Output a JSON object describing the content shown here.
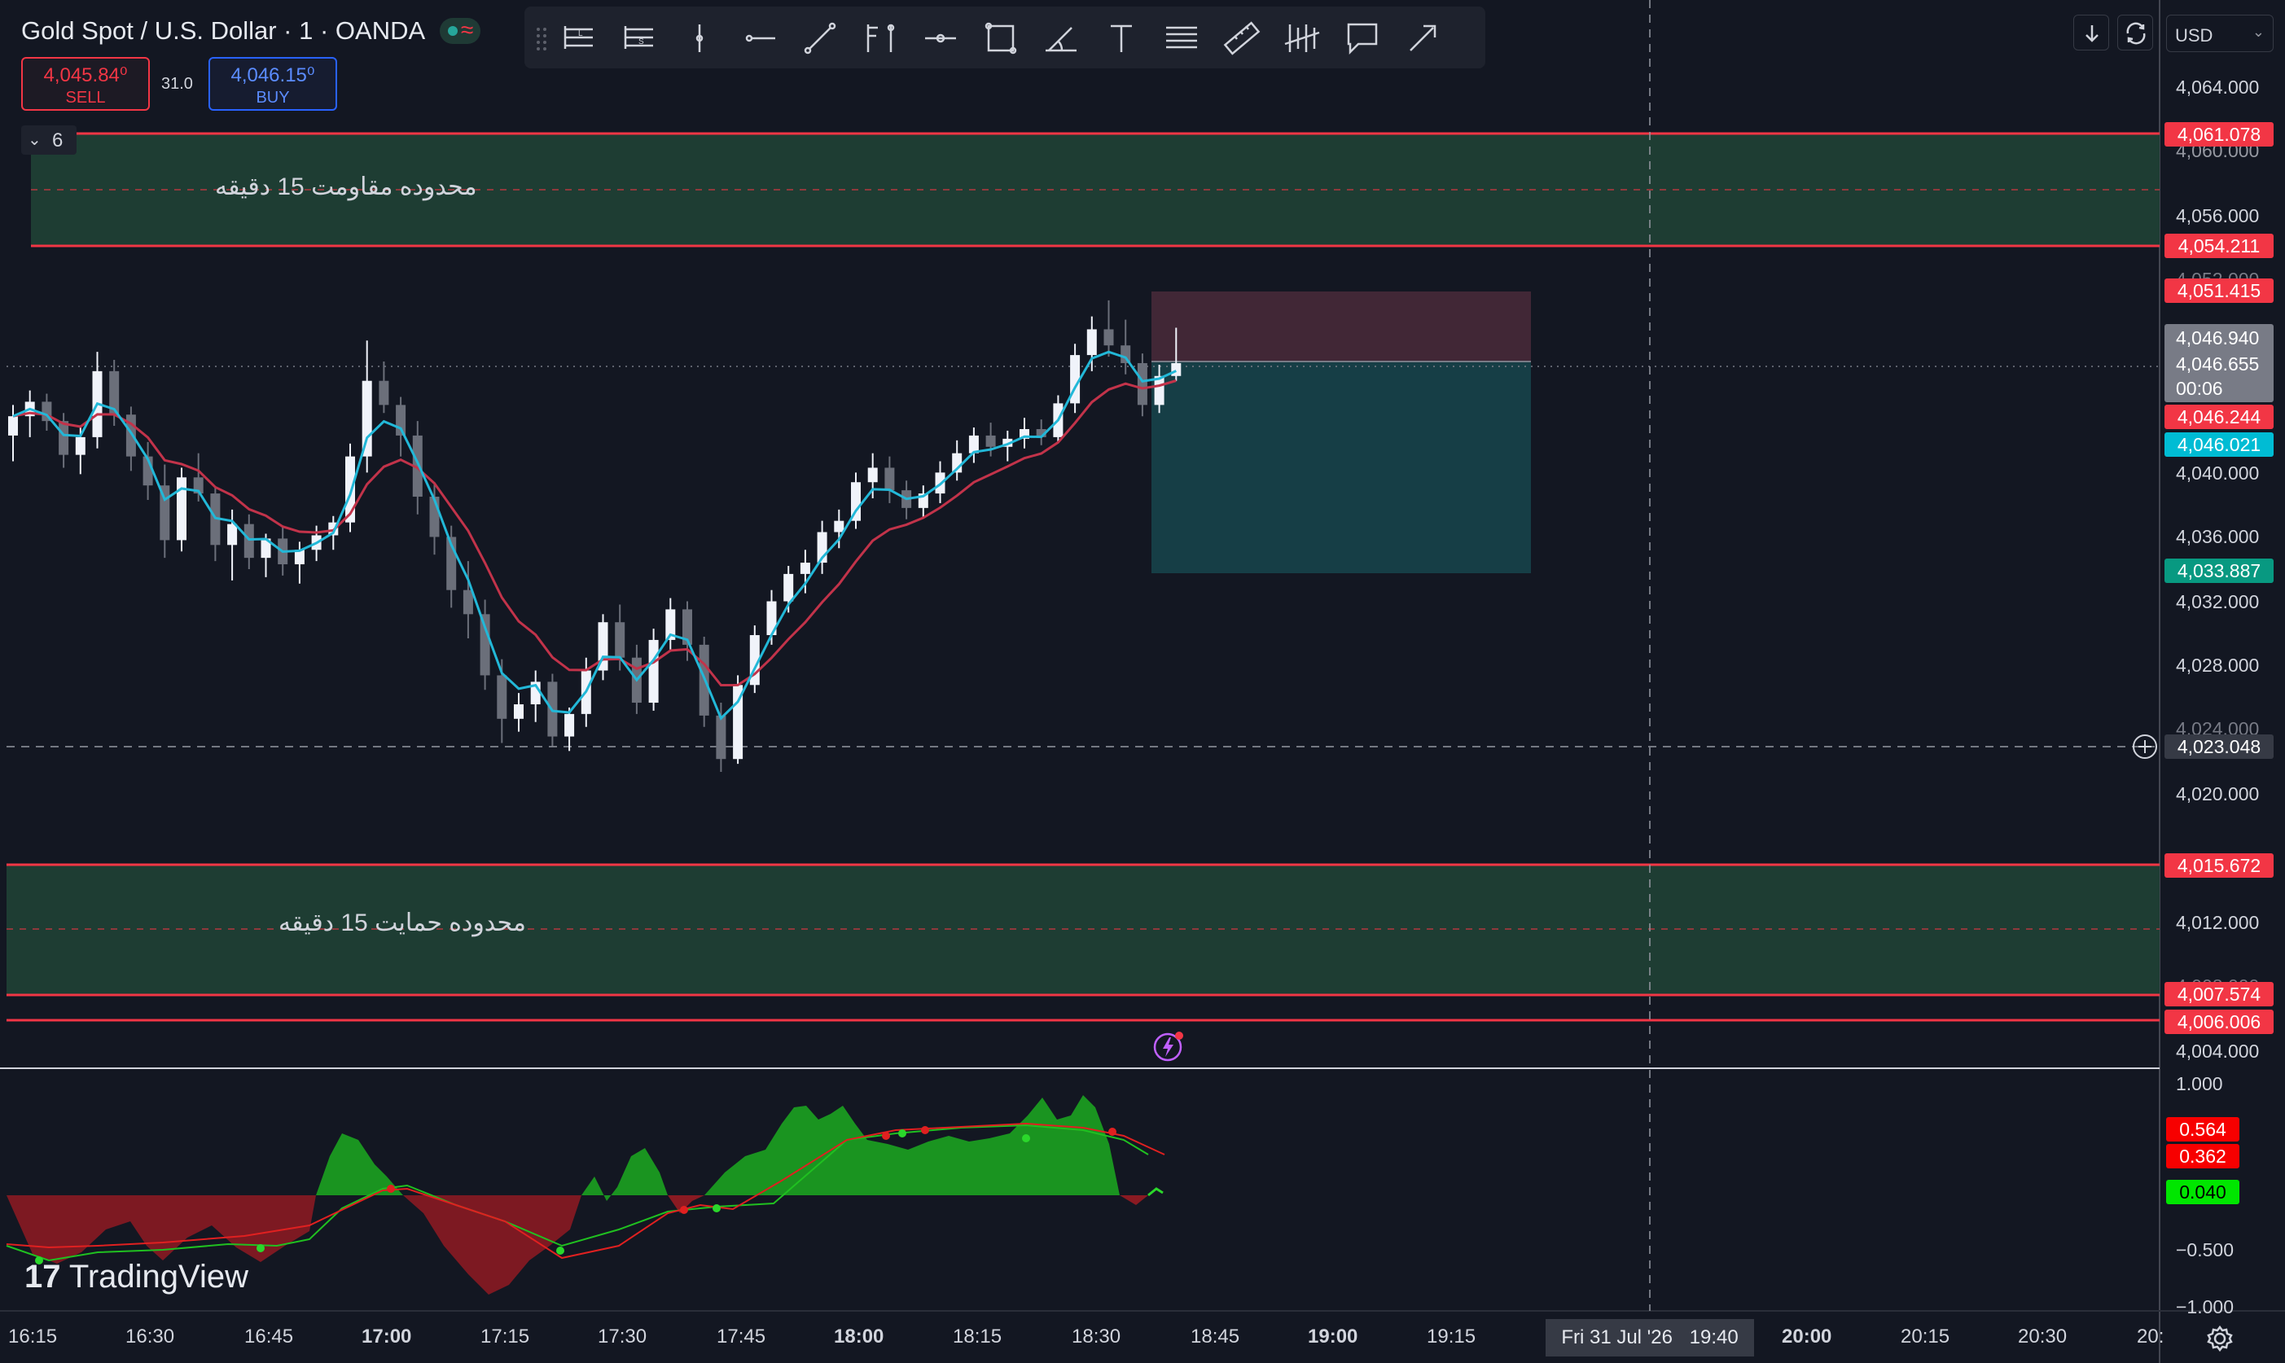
{
  "header": {
    "symbol_title": "Gold Spot / U.S. Dollar · 1 · OANDA",
    "sell_price": "4,045.84⁰",
    "sell_label": "SELL",
    "spread": "31.0",
    "buy_price": "4,046.15⁰",
    "buy_label": "BUY",
    "collapse_count": "6"
  },
  "toolbar": {
    "tools": [
      "long-position-icon",
      "short-position-icon",
      "vertical-line-icon",
      "horizontal-ray-icon",
      "trend-line-icon",
      "pitchfork-icon",
      "arrow-marker-icon",
      "rectangle-icon",
      "angle-icon",
      "text-icon",
      "fib-retracement-icon",
      "ruler-icon",
      "regression-icon",
      "callout-icon",
      "arrow-icon"
    ]
  },
  "top_right": {
    "currency": "USD"
  },
  "zones": {
    "resistance_label": "محدوده مقاومت 15 دقیقه",
    "support_label": "محدوده حمایت 15 دقیقه"
  },
  "price_scale": {
    "ticks": [
      "4,064.000",
      "4,060.000",
      "4,056.000",
      "4,052.000",
      "4,040.000",
      "4,036.000",
      "4,032.000",
      "4,028.000",
      "4,024.000",
      "4,020.000",
      "4,012.000",
      "4,008.000",
      "4,004.000"
    ],
    "labels": {
      "zone_top_high": "4,061.078",
      "zone_top_low": "4,054.211",
      "target": "4,051.415",
      "bid": "4,046.940",
      "last": "4,046.655",
      "countdown": "00:06",
      "ma_red": "4,046.244",
      "ma_blue": "4,046.021",
      "stop": "4,033.887",
      "crosshair": "4,023.048",
      "zone_bottom_high": "4,015.672",
      "zone_bottom_low": "4,007.574",
      "line_bottom": "4,006.006"
    }
  },
  "oscillator_scale": {
    "ticks": [
      "1.000",
      "−0.500",
      "−1.000"
    ],
    "labels": {
      "a": "0.564",
      "b": "0.362",
      "c": "0.040"
    }
  },
  "time_axis": {
    "ticks": [
      "16:15",
      "16:30",
      "16:45",
      "17:00",
      "17:15",
      "17:30",
      "17:45",
      "18:00",
      "18:15",
      "18:30",
      "18:45",
      "19:00",
      "19:15",
      "20:00",
      "20:15",
      "20:30",
      "20:"
    ],
    "crosshair_date": "Fri 31 Jul '26",
    "crosshair_time": "19:40"
  },
  "branding": {
    "logo_text": "TradingView"
  },
  "chart_data": {
    "type": "candlestick",
    "title": "Gold Spot / U.S. Dollar · 1 · OANDA",
    "x": [
      "16:15",
      "16:30",
      "16:45",
      "17:00",
      "17:15",
      "17:30",
      "17:45",
      "18:00",
      "18:15",
      "18:30",
      "18:45"
    ],
    "ylim": [
      4004,
      4066
    ],
    "candles": [
      [
        4042.2,
        4044.1,
        4040.6,
        4043.4
      ],
      [
        4043.4,
        4045.0,
        4042.1,
        4044.3
      ],
      [
        4044.3,
        4044.8,
        4042.5,
        4043.1
      ],
      [
        4043.1,
        4043.6,
        4040.2,
        4041.0
      ],
      [
        4041.0,
        4042.7,
        4039.8,
        4042.1
      ],
      [
        4042.1,
        4047.4,
        4041.4,
        4046.2
      ],
      [
        4046.2,
        4046.9,
        4042.8,
        4043.5
      ],
      [
        4043.5,
        4044.0,
        4040.0,
        4040.9
      ],
      [
        4040.9,
        4041.8,
        4038.2,
        4039.1
      ],
      [
        4039.1,
        4040.4,
        4034.6,
        4035.7
      ],
      [
        4035.7,
        4040.2,
        4035.0,
        4039.6
      ],
      [
        4039.6,
        4041.1,
        4038.1,
        4038.6
      ],
      [
        4038.6,
        4039.0,
        4034.4,
        4035.4
      ],
      [
        4035.4,
        4037.6,
        4033.2,
        4036.7
      ],
      [
        4036.7,
        4037.3,
        4033.9,
        4034.6
      ],
      [
        4034.6,
        4036.1,
        4033.4,
        4035.8
      ],
      [
        4035.8,
        4036.5,
        4033.5,
        4034.2
      ],
      [
        4034.2,
        4035.6,
        4033.0,
        4035.1
      ],
      [
        4035.1,
        4036.6,
        4034.4,
        4036.0
      ],
      [
        4036.0,
        4037.2,
        4035.1,
        4036.8
      ],
      [
        4036.8,
        4041.7,
        4036.2,
        4040.9
      ],
      [
        4040.9,
        4048.1,
        4039.9,
        4045.6
      ],
      [
        4045.6,
        4046.8,
        4043.6,
        4044.1
      ],
      [
        4044.1,
        4044.6,
        4040.9,
        4042.2
      ],
      [
        4042.2,
        4043.1,
        4037.3,
        4038.4
      ],
      [
        4038.4,
        4039.3,
        4034.8,
        4035.9
      ],
      [
        4035.9,
        4036.6,
        4031.5,
        4032.6
      ],
      [
        4032.6,
        4034.4,
        4029.6,
        4031.1
      ],
      [
        4031.1,
        4032.0,
        4026.4,
        4027.3
      ],
      [
        4027.3,
        4028.3,
        4023.1,
        4024.6
      ],
      [
        4024.6,
        4026.2,
        4023.8,
        4025.5
      ],
      [
        4025.5,
        4027.6,
        4024.4,
        4026.9
      ],
      [
        4026.9,
        4027.4,
        4022.9,
        4023.5
      ],
      [
        4023.5,
        4025.3,
        4022.6,
        4024.9
      ],
      [
        4024.9,
        4028.4,
        4024.1,
        4027.6
      ],
      [
        4027.6,
        4031.1,
        4027.0,
        4030.6
      ],
      [
        4030.6,
        4031.7,
        4027.6,
        4028.4
      ],
      [
        4028.4,
        4029.2,
        4024.9,
        4025.6
      ],
      [
        4025.6,
        4030.2,
        4025.1,
        4029.5
      ],
      [
        4029.5,
        4032.1,
        4028.9,
        4031.4
      ],
      [
        4031.4,
        4031.9,
        4028.2,
        4029.2
      ],
      [
        4029.2,
        4029.7,
        4024.1,
        4024.8
      ],
      [
        4024.8,
        4025.6,
        4021.3,
        4022.1
      ],
      [
        4022.1,
        4027.3,
        4021.8,
        4026.7
      ],
      [
        4026.7,
        4030.4,
        4026.2,
        4029.8
      ],
      [
        4029.8,
        4032.6,
        4029.2,
        4031.9
      ],
      [
        4031.9,
        4034.1,
        4031.2,
        4033.6
      ],
      [
        4033.6,
        4035.1,
        4032.4,
        4034.3
      ],
      [
        4034.3,
        4036.9,
        4033.6,
        4036.2
      ],
      [
        4036.2,
        4037.6,
        4035.2,
        4036.9
      ],
      [
        4036.9,
        4039.9,
        4036.4,
        4039.3
      ],
      [
        4039.3,
        4041.1,
        4038.3,
        4040.2
      ],
      [
        4040.2,
        4040.9,
        4038.0,
        4038.8
      ],
      [
        4038.8,
        4039.4,
        4037.0,
        4037.7
      ],
      [
        4037.7,
        4039.1,
        4037.1,
        4038.6
      ],
      [
        4038.6,
        4040.6,
        4038.0,
        4039.9
      ],
      [
        4039.9,
        4041.9,
        4039.4,
        4041.1
      ],
      [
        4041.1,
        4042.7,
        4040.5,
        4042.2
      ],
      [
        4042.2,
        4043.0,
        4040.9,
        4041.5
      ],
      [
        4041.5,
        4042.5,
        4040.6,
        4042.0
      ],
      [
        4042.0,
        4043.3,
        4041.4,
        4042.6
      ],
      [
        4042.6,
        4043.2,
        4041.6,
        4042.1
      ],
      [
        4042.1,
        4044.7,
        4041.8,
        4044.2
      ],
      [
        4044.2,
        4047.9,
        4043.6,
        4047.2
      ],
      [
        4047.2,
        4049.6,
        4046.2,
        4048.8
      ],
      [
        4048.8,
        4050.6,
        4047.1,
        4047.8
      ],
      [
        4047.8,
        4049.4,
        4046.0,
        4046.7
      ],
      [
        4046.7,
        4047.3,
        4043.4,
        4044.1
      ],
      [
        4044.1,
        4046.6,
        4043.6,
        4045.9
      ],
      [
        4045.9,
        4048.9,
        4045.6,
        4046.7
      ]
    ]
  }
}
